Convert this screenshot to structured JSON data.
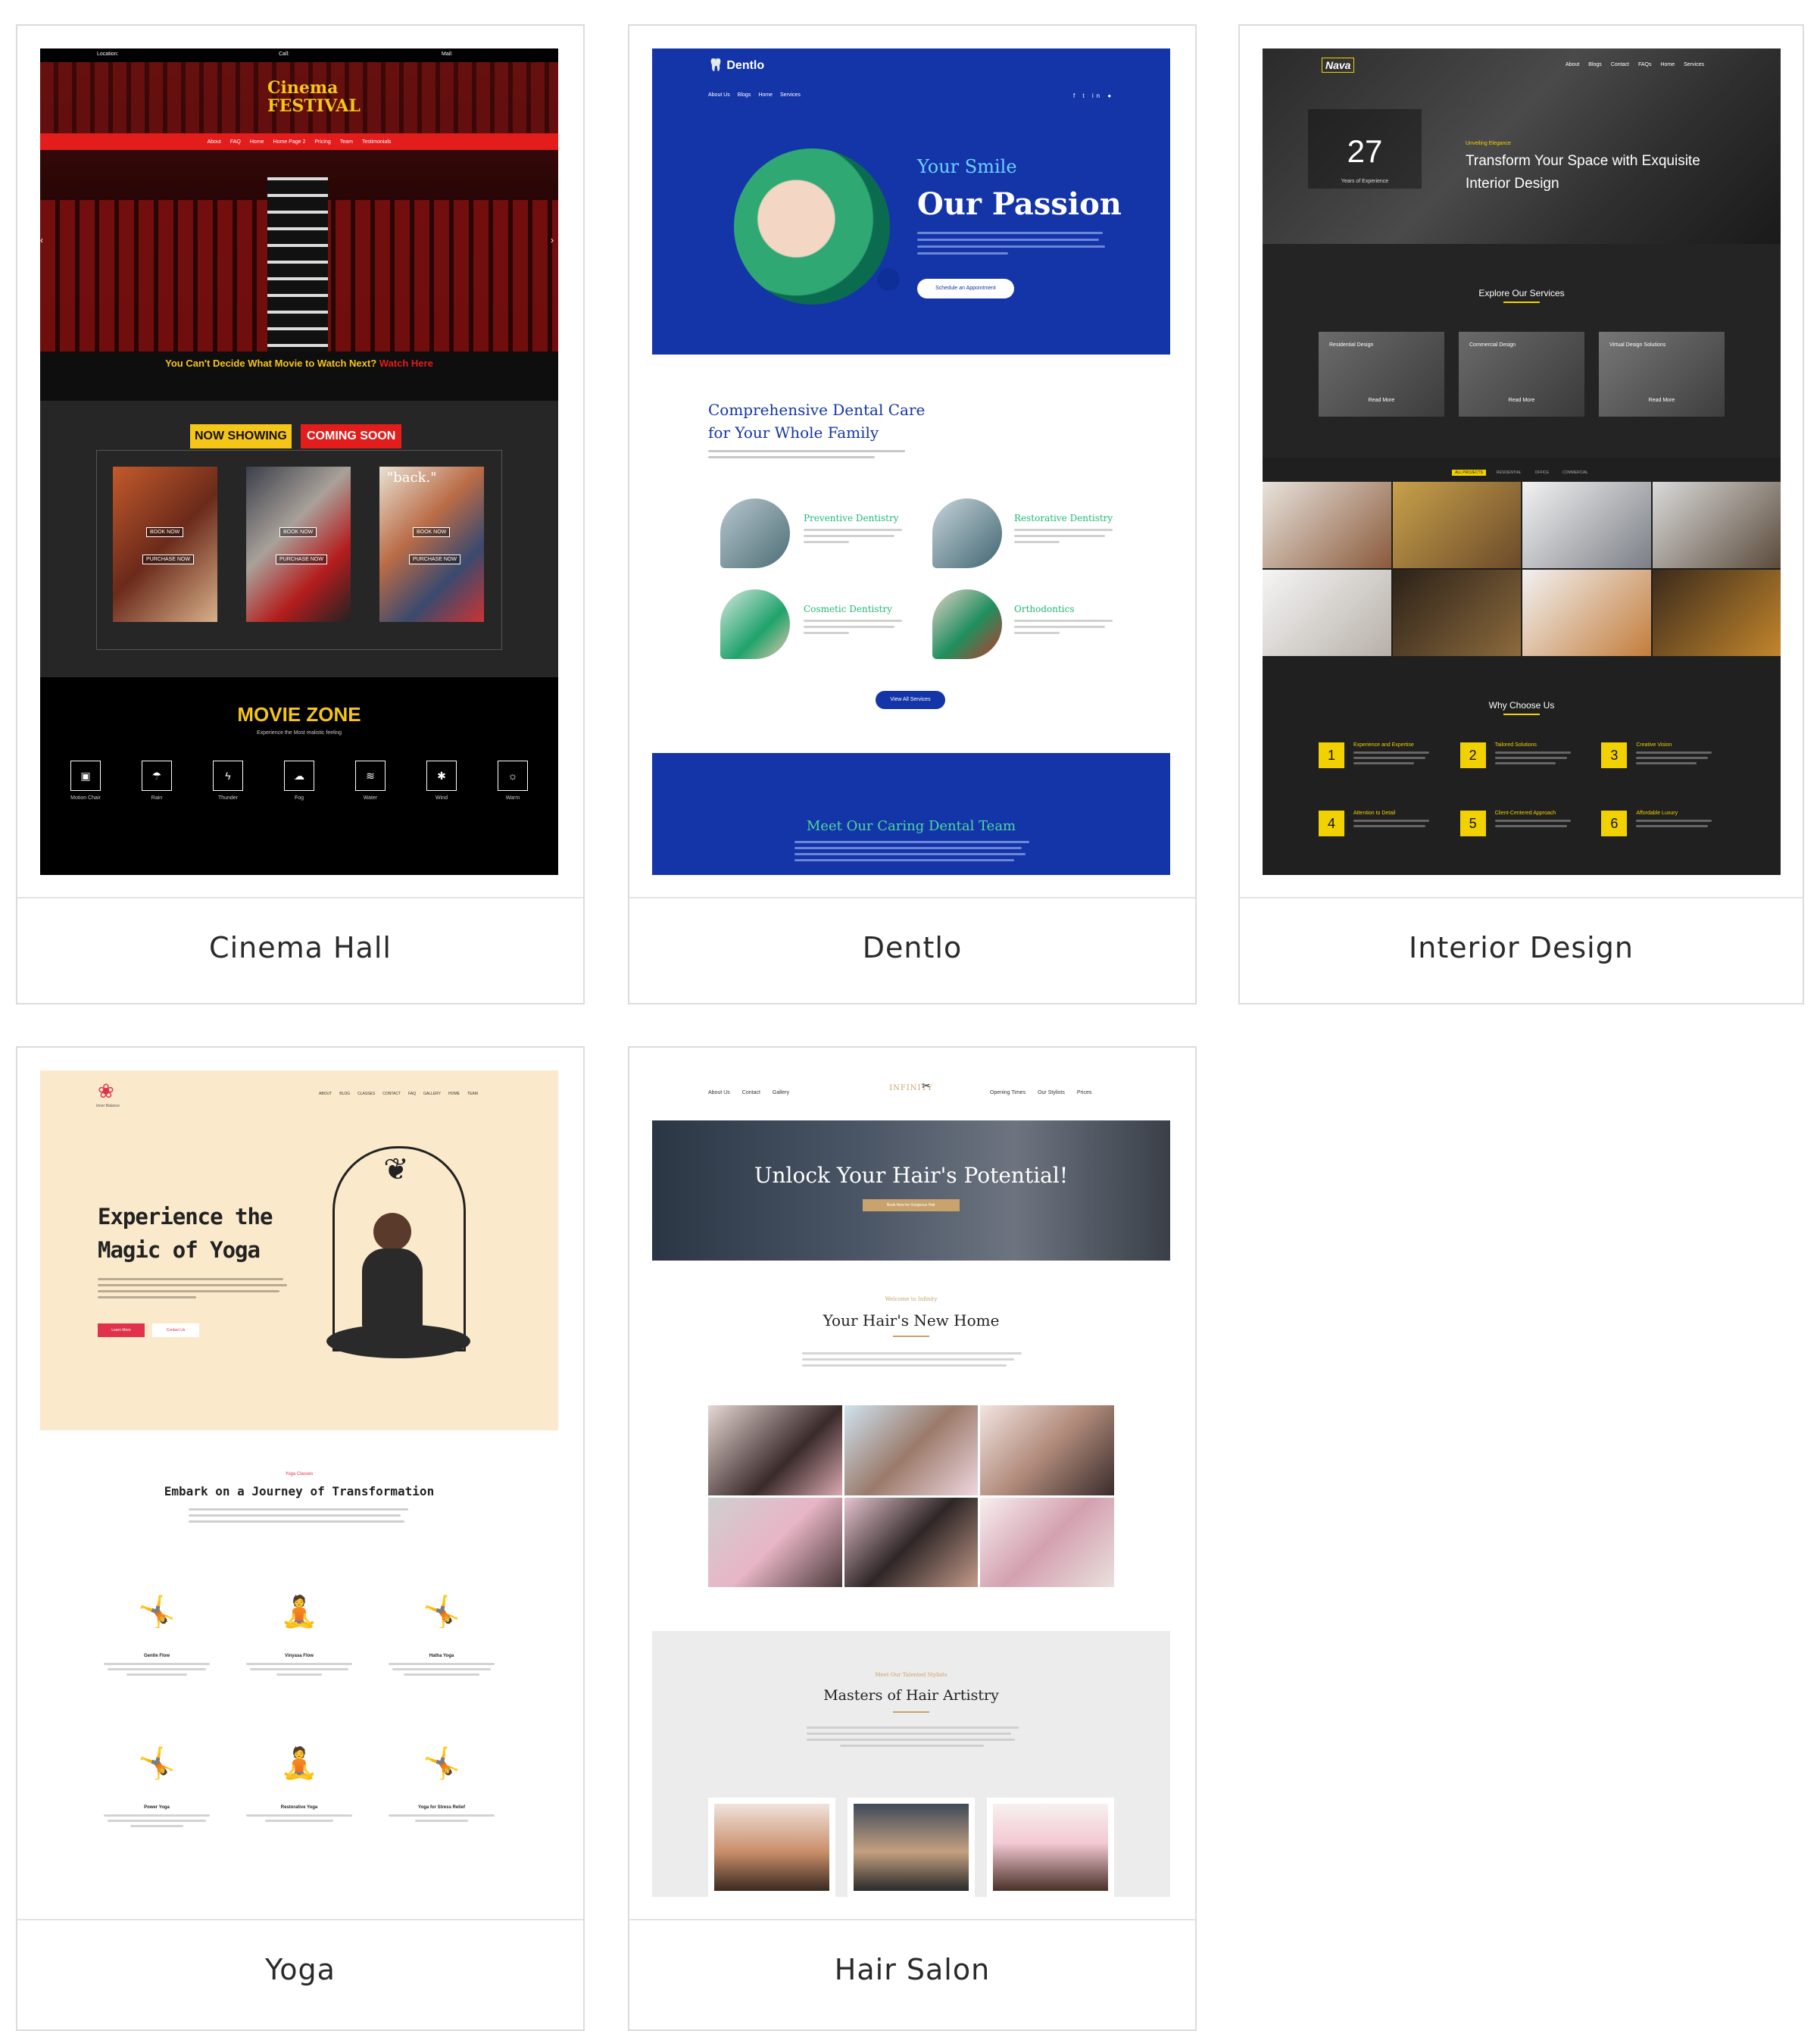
{
  "cards": [
    {
      "title": "Cinema Hall",
      "preview": {
        "top_bar": [
          "Location:",
          "Call:",
          "Mail:"
        ],
        "logo": "Cinema FESTIVAL",
        "nav": [
          "About",
          "FAQ",
          "Home",
          "Home Page 2",
          "Pricing",
          "Team",
          "Testimonials"
        ],
        "tagline": "You Can't Decide What Movie to Watch Next?",
        "tagline_link": "Watch Here",
        "tabs": [
          "NOW SHOWING",
          "COMING SOON"
        ],
        "poster_buttons": [
          "BOOK NOW",
          "PURCHASE NOW"
        ],
        "poster_3_text": "\"back.\"",
        "zone_title": "MOVIE ZONE",
        "zone_subtitle": "Experience the Most realistic feeling",
        "features": [
          "Motion Chair",
          "Rain",
          "Thunder",
          "Fog",
          "Water",
          "Wind",
          "Warm"
        ]
      }
    },
    {
      "title": "Dentlo",
      "preview": {
        "logo": "Dentlo",
        "nav": [
          "About Us",
          "Blogs",
          "Home",
          "Services"
        ],
        "hero_small": "Your Smile",
        "hero_big": "Our Passion",
        "hero_button": "Schedule an Appointment",
        "section_title": "Comprehensive Dental Care for Your Whole Family",
        "services": [
          {
            "name": "Preventive Dentistry"
          },
          {
            "name": "Restorative Dentistry"
          },
          {
            "name": "Cosmetic Dentistry"
          },
          {
            "name": "Orthodontics"
          }
        ],
        "services_button": "View All Services",
        "team_title": "Meet Our Caring Dental Team"
      }
    },
    {
      "title": "Interior Design",
      "preview": {
        "logo": "Nava",
        "nav": [
          "About",
          "Blogs",
          "Contact",
          "FAQs",
          "Home",
          "Services"
        ],
        "years": "27",
        "years_label": "Years of Experience",
        "eyebrow": "Unveiling Elegance",
        "hero_title": "Transform Your Space with Exquisite Interior Design",
        "services_title": "Explore Our Services",
        "services": [
          "Residential Design",
          "Commercial Design",
          "Virtual Design Solutions"
        ],
        "read_more": "Read More",
        "filters": [
          "ALL PROJECTS",
          "RESIDENTIAL",
          "OFFICE",
          "COMMERCIAL"
        ],
        "why_title": "Why Choose Us",
        "reasons": [
          {
            "num": "1",
            "label": "Experience and Expertise"
          },
          {
            "num": "2",
            "label": "Tailored Solutions"
          },
          {
            "num": "3",
            "label": "Creative Vision"
          },
          {
            "num": "4",
            "label": "Attention to Detail"
          },
          {
            "num": "5",
            "label": "Client-Centered Approach"
          },
          {
            "num": "6",
            "label": "Affordable Luxury"
          }
        ]
      }
    },
    {
      "title": "Yoga",
      "preview": {
        "logo_text": "Inner Balance",
        "nav": [
          "ABOUT",
          "BLOG",
          "CLASSES",
          "CONTACT",
          "FAQ",
          "GALLERY",
          "HOME",
          "TEAM"
        ],
        "hero_title_1": "Experience the",
        "hero_title_2": "Magic of Yoga",
        "btn_primary": "Learn More",
        "btn_secondary": "Contact Us",
        "eyebrow": "Yoga Classes",
        "section_title": "Embark on a Journey of Transformation",
        "classes": [
          "Gentle Flow",
          "Vinyasa Flow",
          "Hatha Yoga",
          "Power Yoga",
          "Restorative Yoga",
          "Yoga for Stress Relief"
        ]
      }
    },
    {
      "title": "Hair Salon",
      "preview": {
        "nav_left": [
          "About Us",
          "Contact",
          "Gallery"
        ],
        "logo": "INFINITY",
        "nav_right": [
          "Opening Times",
          "Our Stylists",
          "Prices"
        ],
        "hero_title": "Unlock Your Hair's Potential!",
        "hero_button": "Book Now for Gorgeous Hair",
        "eyebrow": "Welcome to Infinity",
        "section_title": "Your Hair's New Home",
        "team_eyebrow": "Meet Our Talented Stylists",
        "team_title": "Masters of Hair Artistry"
      }
    }
  ],
  "colors": {
    "cinema_red": "#e31c1c",
    "cinema_yellow": "#f5c518",
    "dentlo_blue": "#1435a8",
    "interior_yellow": "#f2d100",
    "yoga_cream": "#faeacb",
    "yoga_red": "#e1314b",
    "salon_gold": "#c9a36b"
  }
}
